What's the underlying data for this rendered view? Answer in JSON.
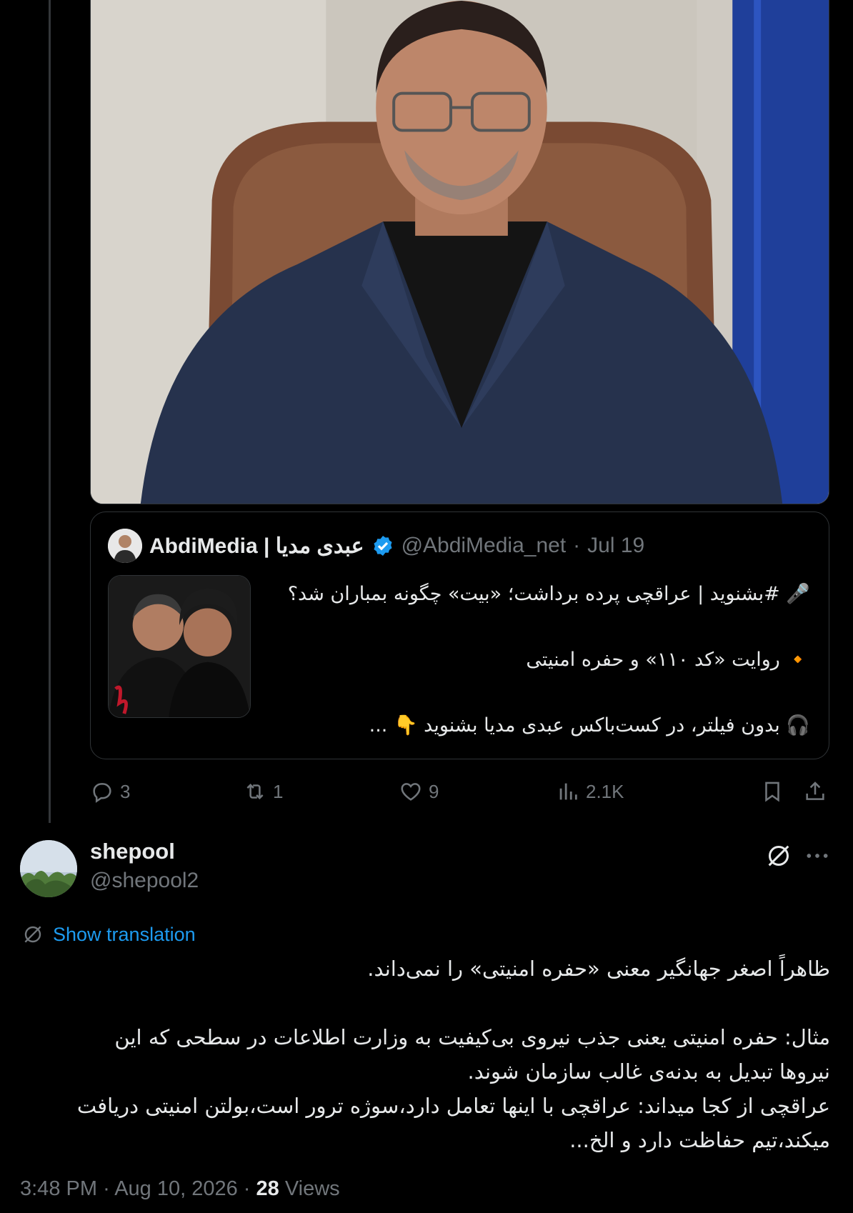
{
  "quoted_tweet": {
    "display_name": "AbdiMedia | عبدی مدیا",
    "handle": "@AbdiMedia_net",
    "date": "Jul 19",
    "lines": [
      "🎤 #بشنوید | عراقچی پرده برداشت؛ «بیت» چگونه بمباران شد؟",
      "🔸 روایت «کد ۱۱۰» و حفره امنیتی",
      "🎧 بدون فیلتر، در کست‌باکس عبدی مدیا بشنوید 👇 ..."
    ]
  },
  "actions": {
    "replies": "3",
    "reposts": "1",
    "likes": "9",
    "views": "2.1K"
  },
  "reply": {
    "display_name": "shepool",
    "handle": "@shepool2",
    "show_translation": "Show translation",
    "paragraph1": [
      "ظاهراً اصغر جهانگیر معنی «حفره امنیتی» را نمی‌داند."
    ],
    "paragraph2": [
      "مثال: حفره امنیتی یعنی جذب نیروی بی‌کیفیت به وزارت اطلاعات در سطحی که این",
      "نیروها تبدیل به بدنه‌ی غالب سازمان شوند.",
      "عراقچی از کجا میداند: عراقچی با اینها تعامل دارد،سوژه ترور است،بولتن امنیتی دریافت",
      "میکند،تیم حفاظت دارد و الخ..."
    ],
    "time": "3:48 PM",
    "date": "Aug 10, 2026",
    "views_count": "28",
    "views_label": "Views"
  },
  "colors": {
    "background": "#000000",
    "text": "#e7e9ea",
    "muted": "#71767b",
    "accent": "#1d9bf0",
    "border": "#2f3336"
  }
}
